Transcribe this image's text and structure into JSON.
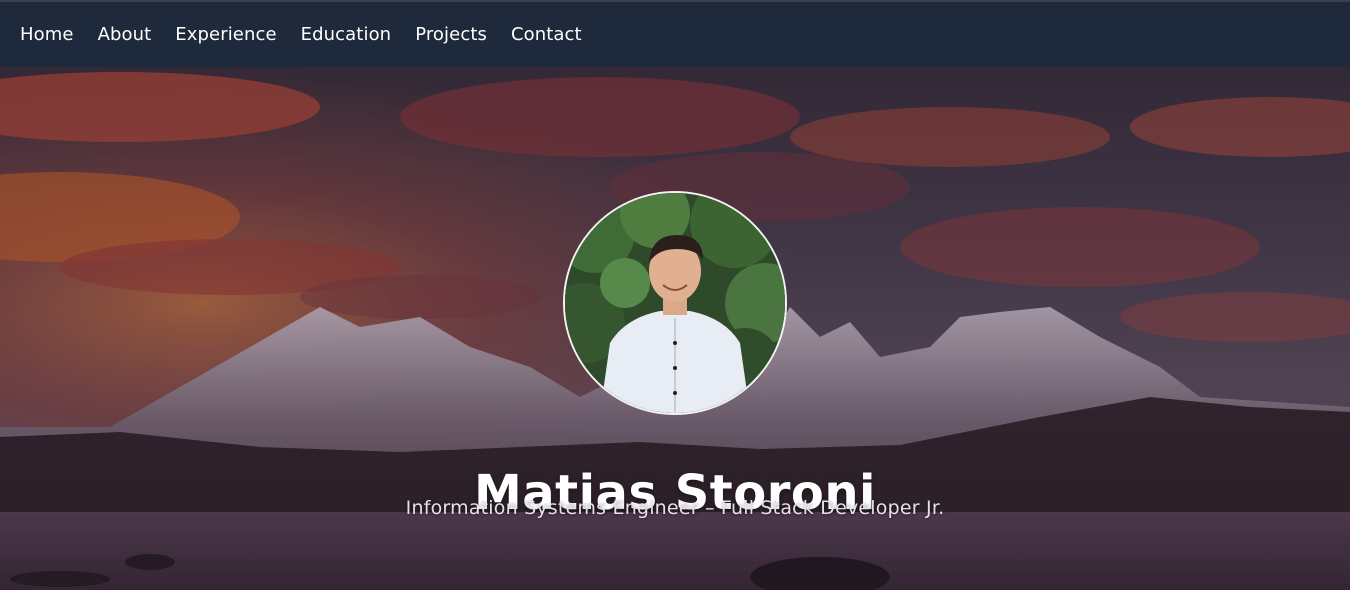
{
  "nav": {
    "items": [
      {
        "label": "Home"
      },
      {
        "label": "About"
      },
      {
        "label": "Experience"
      },
      {
        "label": "Education"
      },
      {
        "label": "Projects"
      },
      {
        "label": "Contact"
      }
    ]
  },
  "hero": {
    "name": "Matias Storoni",
    "subtitle": "Information Systems Engineer – Full Stack Developer Jr."
  },
  "colors": {
    "navbar_bg": "#1e293b",
    "nav_text": "#ffffff",
    "sky_dark": "#3b3548",
    "cloud_orange": "#c4553a",
    "mountain": "#6e6272",
    "water": "#4a3a4a"
  },
  "icons": {
    "avatar": "profile-photo"
  }
}
